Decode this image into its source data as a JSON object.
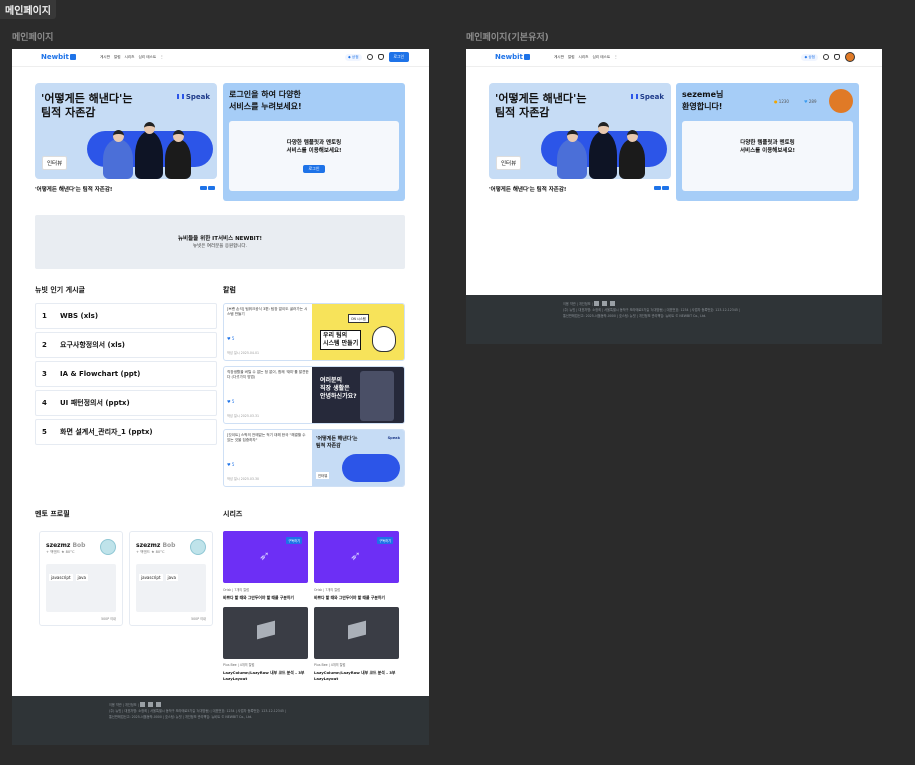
{
  "page_tag": "메인페이지",
  "frames": {
    "left_label": "메인페이지",
    "right_label": "메인페이지(기본유저)"
  },
  "header": {
    "logo": "Newbit",
    "nav": [
      "게시판",
      "칼럼",
      "시리즈",
      "심리 테스트",
      "⋮"
    ],
    "points_label": "상점",
    "login_button": "로그인"
  },
  "hero": {
    "title_line1": "'어떻게든 해낸다'는",
    "title_line2": "팀적 자존감",
    "brand": "Speak",
    "tag": "인터뷰",
    "caption": "'어떻게든 해낸다'는 팀적 자존감!"
  },
  "login_card": {
    "title_line1": "로그인을 하여 다양한",
    "title_line2": "서비스를 누려보세요!",
    "msg_line1": "다양한 템플릿과 멘토링",
    "msg_line2": "서비스를 이용해보세요!",
    "button": "로그인"
  },
  "user_card": {
    "greeting_line1": "sezeme님",
    "greeting_line2": "환영합니다!",
    "coins": "1230",
    "diamonds": "289",
    "msg_line1": "다양한 템플릿과 멘토링",
    "msg_line2": "서비스를 이용해보세요!"
  },
  "banner": {
    "title": "뉴비들을 위한 IT서비스 NEWBIT!",
    "subtitle": "뉴빗은 여러분을 응원합니다."
  },
  "popular": {
    "title": "뉴빗 인기 게시글",
    "items": [
      {
        "rank": "1",
        "label": "WBS (xls)"
      },
      {
        "rank": "2",
        "label": "요구사항정의서 (xls)"
      },
      {
        "rank": "3",
        "label": "IA & Flowchart (ppt)"
      },
      {
        "rank": "4",
        "label": "UI 패턴정의서 (pptx)"
      },
      {
        "rank": "5",
        "label": "화면 설계서_관리자_1 (pptx)"
      }
    ]
  },
  "column": {
    "title": "칼럼",
    "cards": [
      {
        "text": "[브랜 손석] 팀워크공식 3편: 팀장 없이도 굴러가는 시스템 만들기",
        "likes": "5",
        "meta": "작성 일시  2025.04.01",
        "img_text_1": "우리 팀의",
        "img_text_2": "시스템 만들기",
        "img_badge": "ON 시스템"
      },
      {
        "text": "직장생활을 버틸 수 없는 정 없이, 함께 '재미'를 발견한다 (다섯가지 방법)",
        "likes": "5",
        "meta": "작성 일시  2025.03.31",
        "img_text_1": "여러분의",
        "img_text_2": "직장 생활은",
        "img_text_3": "안녕하신가요?"
      },
      {
        "text": "[갓이트] 스픽의 전에없는 적기 대해 한국 \"해결할 수 있는 것을 집중하자\"",
        "likes": "5",
        "meta": "작성 일시  2025.03.30",
        "img_text_1": "'어떻게든 해낸다'는",
        "img_text_2": "팀적 자존감",
        "img_badge": "Speak",
        "img_tag": "인터뷰"
      }
    ]
  },
  "mentors": {
    "title": "멘토 프로필",
    "cards": [
      {
        "name": "szezmz",
        "handle": "Bob",
        "sub": "백엔드",
        "temp": "80°C",
        "skills": [
          "javascript",
          "java"
        ],
        "price": "500P  이내"
      },
      {
        "name": "szezmz",
        "handle": "Bob",
        "sub": "백엔드",
        "temp": "80°C",
        "skills": [
          "javascript",
          "java"
        ],
        "price": "500P  이내"
      }
    ]
  },
  "series": {
    "title": "시리즈",
    "items": [
      {
        "badge": "구독하기",
        "meta": "Orisk  |  7개의 칼럼",
        "title": "바쁘다 할 때와 그만두어야 할 때를 구분하기"
      },
      {
        "badge": "구독하기",
        "meta": "Orisk  |  7개의 칼럼",
        "title": "바쁘다 할 때와 그만두어야 할 때를 구분하기"
      },
      {
        "meta": "Plus Bee  |  4개의 칼럼",
        "title": "LazyColumn/LazyRow 내부 코드 분석 – 3부 LazyLayout"
      },
      {
        "meta": "Plus Bee  |  4개의 칼럼",
        "title": "LazyColumn/LazyRow 내부 코드 분석 – 3부 LazyLayout"
      }
    ]
  },
  "footer": {
    "links": "이용 약관  |  개인정보  |",
    "line1": "(주) 뉴빗  |  대표자명: 소정희  |  서울특별시 동작구 보라매로5가길 7(대방동)  |  대표번호: 1234  |  사업자 등록번호: 123-12-12345  |",
    "line2": "통신판매업신고: 2025-서울동작-0000  |  호스팅: 뉴빗  |  개인정보 관리책임: 뉴비트    © NEWBIT Co., Ltd."
  },
  "colors": {
    "accent": "#1e73e8",
    "hero_bg": "#c6dcf5",
    "side_card": "#a6cdf7",
    "series_purple": "#6d2ff5",
    "series_dark": "#3a3d45",
    "footer": "#2f3437"
  },
  "icons": [
    "message-icon",
    "bell-icon",
    "coin-icon",
    "diamond-icon",
    "heart-icon",
    "rocket-icon",
    "box-icon",
    "facebook-icon",
    "twitter-icon",
    "instagram-icon"
  ]
}
